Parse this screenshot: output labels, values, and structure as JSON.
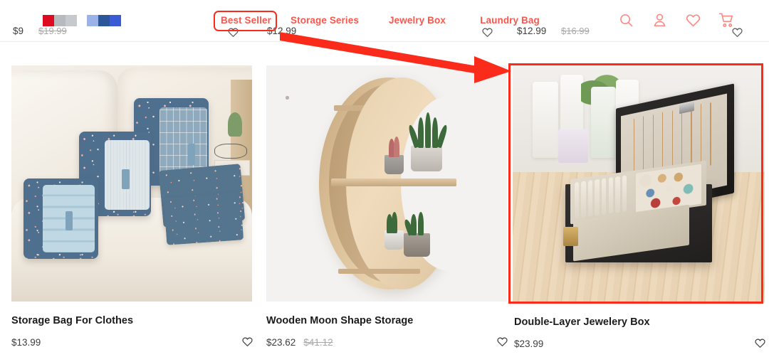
{
  "header": {
    "logo_swatches": [
      {
        "name": "swatch-red",
        "color": "#dd0b20"
      },
      {
        "name": "swatch-grey-mid",
        "color": "#b7bbc0"
      },
      {
        "name": "swatch-grey-light",
        "color": "#c7cacd"
      },
      {
        "name": "swatch-blue-light",
        "color": "#9bb2e8"
      },
      {
        "name": "swatch-blue-dark",
        "color": "#2b5699"
      },
      {
        "name": "swatch-blue",
        "color": "#3b5bd4"
      }
    ],
    "nav": [
      {
        "label": "Best Seller",
        "active": true
      },
      {
        "label": "Storage Series",
        "active": false
      },
      {
        "label": "Jewelry Box",
        "active": false
      },
      {
        "label": "Laundry Bag",
        "active": false
      }
    ],
    "icons": [
      {
        "name": "search-icon",
        "label": "Search"
      },
      {
        "name": "account-icon",
        "label": "Account"
      },
      {
        "name": "wishlist-heart-icon",
        "label": "Wishlist"
      },
      {
        "name": "shopping-cart-icon",
        "label": "Cart"
      }
    ],
    "nav_color": "#fc564c",
    "icon_color": "#fb8a85"
  },
  "cut_off_row": [
    {
      "price": "$9",
      "old_price": "$19.99"
    },
    {
      "price": "$12.99",
      "old_price": ""
    },
    {
      "price": "$12.99",
      "old_price": "$16.99"
    }
  ],
  "products": [
    {
      "title": "Storage Bag For Clothes",
      "price": "$13.99",
      "old_price": "",
      "image_alt": "Set of floral patterned travel storage bags arranged on a cream sofa",
      "highlighted": false
    },
    {
      "title": "Wooden Moon Shape Storage",
      "price": "$23.62",
      "old_price": "$41.12",
      "image_alt": "Crescent moon shaped wooden wall shelf holding potted succulents",
      "highlighted": false
    },
    {
      "title": "Double-Layer Jewelery Box",
      "price": "$23.99",
      "old_price": "",
      "image_alt": "Open black double-layer jewelry box with necklaces, rings and earrings on a wooden table",
      "highlighted": true
    }
  ],
  "annotation": {
    "arrow_color": "#fb2b1c",
    "highlight_color": "#fb2b1c",
    "target_label": "Double-Layer Jewelery Box"
  }
}
